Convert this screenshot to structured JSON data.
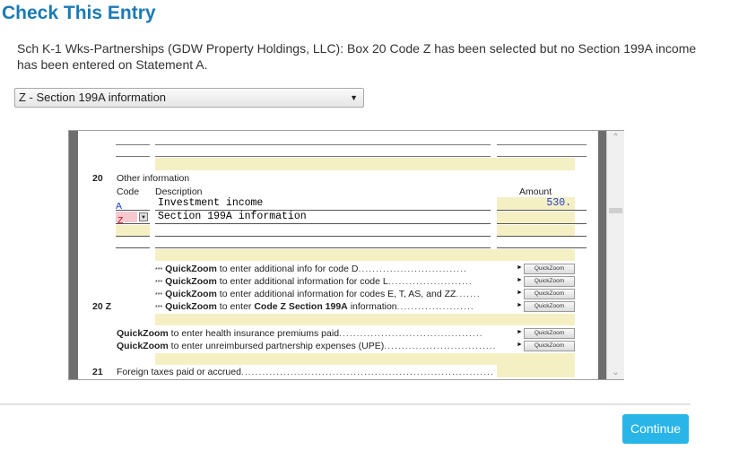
{
  "dialog": {
    "title": "Check This Entry",
    "message": "Sch K-1 Wks-Partnerships (GDW Property Holdings, LLC): Box 20 Code Z has been selected but no Section 199A income has been entered on Statement A.",
    "select_value": "Z - Section 199A information",
    "continue_label": "Continue"
  },
  "form": {
    "line20_num": "20",
    "line20_label": "Other information",
    "col_code": "Code",
    "col_desc": "Description",
    "col_amount": "Amount",
    "rows": [
      {
        "code": "A",
        "description": "Investment income",
        "amount": "530."
      },
      {
        "code": "Z",
        "description": "Section 199A information",
        "amount": ""
      }
    ],
    "quickzoom_lines": [
      {
        "prefix": "***",
        "bold": "QuickZoom",
        "text": " to enter additional info for code D",
        "bold2": "",
        "text2": ""
      },
      {
        "prefix": "***",
        "bold": "QuickZoom",
        "text": " to enter additional information for code L",
        "bold2": "",
        "text2": ""
      },
      {
        "prefix": "***",
        "bold": "QuickZoom",
        "text": " to enter additional information for codes E, T, AS, and ZZ",
        "bold2": "",
        "text2": ""
      },
      {
        "prefix": "***",
        "bold": "QuickZoom",
        "text": " to enter ",
        "bold2": "Code Z Section 199A",
        "text2": " information"
      }
    ],
    "line20z_label": "20 Z",
    "quickzoom_lines2": [
      {
        "bold": "QuickZoom",
        "text": " to enter health insurance premiums paid"
      },
      {
        "bold": "QuickZoom",
        "text": " to enter unreimbursed partnership expenses (UPE)"
      }
    ],
    "qz_button_label": "QuickZoom",
    "line21_num": "21",
    "line21_label": "Foreign taxes paid or accrued"
  }
}
